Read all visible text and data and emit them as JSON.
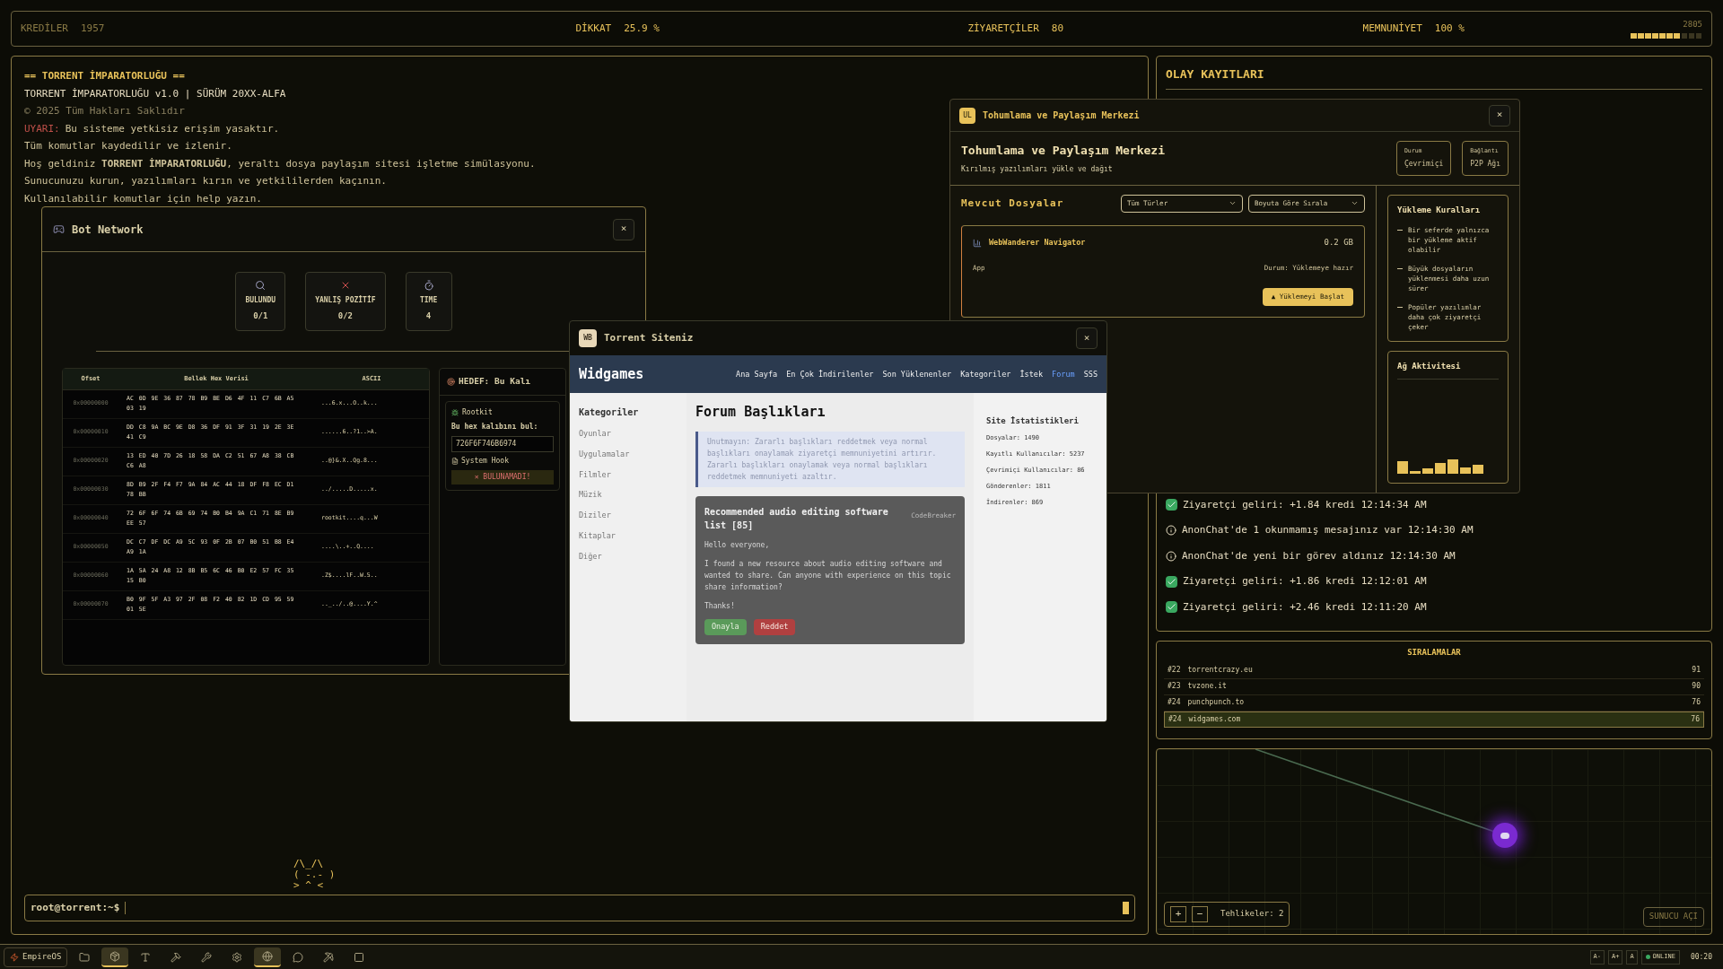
{
  "stats_bar": {
    "items": [
      {
        "label": "KREDİLER",
        "value": "1957",
        "kind": "dim"
      },
      {
        "label": "DİKKAT",
        "value": "25.9 %",
        "kind": "bright"
      },
      {
        "label": "ZİYARETÇİLER",
        "value": "80",
        "kind": "bright"
      },
      {
        "label": "MEMNUNİYET",
        "value": "100 %",
        "kind": "bright"
      }
    ],
    "meter": {
      "reading": "2805",
      "level": 0.7
    }
  },
  "terminal": {
    "lines": [
      {
        "kind": "heading",
        "text": "== TORRENT İMPARATORLUĞU =="
      },
      {
        "kind": "bright",
        "text": "TORRENT İMPARATORLUĞU v1.0 | SÜRÜM 20XX-ALFA"
      },
      {
        "kind": "dim",
        "text": "© 2025 Tüm Hakları Saklıdır"
      },
      {
        "kind": "warning",
        "label": "UYARI:",
        "text": "Bu sisteme yetkisiz erişim yasaktır."
      },
      {
        "kind": "normal",
        "text": "Tüm komutlar kaydedilir ve izlenir."
      },
      {
        "kind": "normal",
        "text": "Hoş geldiniz **TORRENT İMPARATORLUĞU**, yeraltı dosya paylaşım sitesi işletme simülasyonu."
      },
      {
        "kind": "normal",
        "text": "Sunucunuzu kurun, yazılımları kırın ve yetkililerden kaçının."
      },
      {
        "kind": "normal",
        "text": "Kullanılabilir komutlar için help yazın."
      }
    ],
    "mascot": [
      "/\\_/\\",
      "( -.- )",
      "> ^ <"
    ],
    "prompt": "root@torrent:~$"
  },
  "bot_network": {
    "title": "Bot Network",
    "close": "×",
    "stats": [
      {
        "kind": "found",
        "label": "BULUNDU",
        "value": "0/1"
      },
      {
        "kind": "false",
        "label": "YANLIŞ POZİTİF",
        "value": "0/2"
      },
      {
        "kind": "time",
        "label": "TIME",
        "value": "4"
      }
    ],
    "table": {
      "columns": [
        "Ofset",
        "Bellek Hex Verisi",
        "ASCII"
      ],
      "rows": [
        [
          "0x00000000",
          "AC 0D 9E 36 87 78 B9 BE D6 4F 11 C7 6B A5 03 19",
          "...6.x...O..k..."
        ],
        [
          "0x00000010",
          "DD C8 9A BC 9E D8 36 DF 91 3F 31 19 2E 3E 41 C9",
          "......6..?1..>A."
        ],
        [
          "0x00000020",
          "13 ED 40 7D 26 18 58 DA C2 51 67 A8 38 CB C6 A8",
          "..@}&.X..Qg.8..."
        ],
        [
          "0x00000030",
          "8D B9 2F F4 F7 9A 84 AC 44 18 DF F8 EC D1 78 BB",
          "../.....D.....x."
        ],
        [
          "0x00000040",
          "72 6F 6F 74 6B 69 74 B0 B4 9A C1 71 8E B9 EE 57",
          "rootkit....q...W"
        ],
        [
          "0x00000050",
          "DC C7 DF DC A9 5C 93 0F 2B 07 B0 51 B8 E4 A9 1A",
          "....\\..+..Q...."
        ],
        [
          "0x00000060",
          "1A 5A 24 A8 12 8B B5 6C 46 B0 E2 57 FC 35 15 B0",
          ".Z$....lF..W.5.."
        ],
        [
          "0x00000070",
          "B0 9F 5F A3 97 2F 08 F2 40 82 1D CD 95 59 01 5E",
          ".._../..@....Y.^"
        ]
      ]
    },
    "target": {
      "title": "HEDEF: Bu Kalı",
      "name": "Rootkit",
      "prompt": "Bu hex kalıbını bul:",
      "value": "726F6F746B6974",
      "hint": "System Hook",
      "result": "✕ BULUNAMADI!"
    }
  },
  "site_window": {
    "badge": "WB",
    "title": "Torrent Siteniz",
    "close": "×",
    "brand": "Widgames",
    "nav": [
      {
        "label": "Ana Sayfa",
        "selected": false
      },
      {
        "label": "En Çok İndirilenler",
        "selected": false
      },
      {
        "label": "Son Yüklenenler",
        "selected": false
      },
      {
        "label": "Kategoriler",
        "selected": false
      },
      {
        "label": "İstek",
        "selected": false
      },
      {
        "label": "Forum",
        "selected": true
      },
      {
        "label": "SSS",
        "selected": false
      }
    ],
    "sidebar": {
      "title": "Kategoriler",
      "items": [
        "Oyunlar",
        "Uygulamalar",
        "Filmler",
        "Müzik",
        "Diziler",
        "Kitaplar",
        "Diğer"
      ]
    },
    "heading": "Forum Başlıkları",
    "notice": "Unutmayın: Zararlı başlıkları reddetmek veya normal başlıkları onaylamak ziyaretçi memnuniyetini artırır. Zararlı başlıkları onaylamak veya normal başlıkları reddetmek memnuniyeti azaltır.",
    "post": {
      "title": "Recommended audio editing software list [85]",
      "author": "CodeBreaker",
      "body": [
        "Hello everyone,",
        "I found a new resource about audio editing software and wanted to share. Can anyone with experience on this topic share information?",
        "Thanks!"
      ],
      "approve": "Onayla",
      "reject": "Reddet"
    },
    "stats": {
      "title": "Site İstatistikleri",
      "lines": [
        "Dosyalar: 1490",
        "Kayıtlı Kullanıcılar: 5237",
        "Çevrimiçi Kullanıcılar: 86",
        "Gönderenler: 1811",
        "İndirenler: 869"
      ]
    }
  },
  "seed_window": {
    "badge": "UL",
    "title": "Tohumlama ve Paylaşım Merkezi",
    "close": "×",
    "heading": "Tohumlama ve Paylaşım Merkezi",
    "subtitle": "Kırılmış yazılımları yükle ve dağıt",
    "status": [
      {
        "label": "Durum",
        "value": "Çevrimiçi"
      },
      {
        "label": "Bağlantı",
        "value": "P2P Ağı"
      }
    ],
    "files_title": "Mevcut Dosyalar",
    "filters": [
      "Tüm Türler",
      "Boyuta Göre Sırala"
    ],
    "file": {
      "name": "WebWanderer Navigator",
      "size": "0.2 GB",
      "type": "App",
      "status": "Durum: Yüklemeye hazır",
      "action": "▲ Yüklemeyi Başlat"
    },
    "rules_title": "Yükleme Kuralları",
    "rules": [
      "Bir seferde yalnızca bir yükleme aktif olabilir",
      "Büyük dosyaların yüklenmesi daha uzun sürer",
      "Popüler yazılımlar daha çok ziyaretçi çeker"
    ],
    "activity_title": "Ağ Aktivitesi"
  },
  "event_log": {
    "title": "OLAY KAYITLARI",
    "entries": [
      {
        "kind": "success",
        "text": "Ziyaretçi geliri: +1.84 kredi 12:14:34 AM"
      },
      {
        "kind": "info",
        "text": "AnonChat'de 1 okunmamış mesajınız var 12:14:30 AM"
      },
      {
        "kind": "info",
        "text": "AnonChat'de yeni bir görev aldınız 12:14:30 AM"
      },
      {
        "kind": "success",
        "text": "Ziyaretçi geliri: +1.86 kredi 12:12:01 AM"
      },
      {
        "kind": "success",
        "text": "Ziyaretçi geliri: +2.46 kredi 12:11:20 AM"
      }
    ]
  },
  "rankings": {
    "title": "SIRALAMALAR",
    "rows": [
      {
        "rank": "#22",
        "site": "torrentcrazy.eu",
        "score": "91",
        "selected": false
      },
      {
        "rank": "#23",
        "site": "tvzone.it",
        "score": "90",
        "selected": false
      },
      {
        "rank": "#24",
        "site": "punchpunch.to",
        "score": "76",
        "selected": false
      },
      {
        "rank": "#24",
        "site": "widgames.com",
        "score": "76",
        "selected": true
      }
    ]
  },
  "map": {
    "zoom_in": "+",
    "zoom_out": "−",
    "threats": "Tehlikeler: 2",
    "action": "SUNUCU AÇI"
  },
  "taskbar": {
    "start": "EmpireOS",
    "apps": [
      {
        "kind": "folder",
        "active": false
      },
      {
        "kind": "box",
        "active": true
      },
      {
        "kind": "text",
        "active": false
      },
      {
        "kind": "hammer",
        "active": false
      },
      {
        "kind": "tool",
        "active": false
      },
      {
        "kind": "gear",
        "active": false
      },
      {
        "kind": "globe",
        "active": true
      },
      {
        "kind": "chat",
        "active": false
      },
      {
        "kind": "pick",
        "active": false
      },
      {
        "kind": "blank",
        "active": false
      }
    ],
    "font_buttons": [
      "A-",
      "A+",
      "A"
    ],
    "status": "ONLINE",
    "clock": "00:20"
  }
}
